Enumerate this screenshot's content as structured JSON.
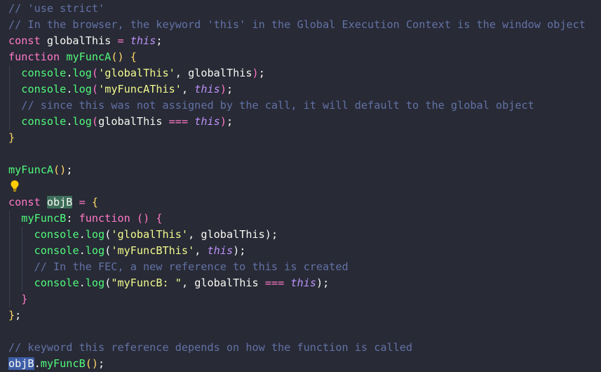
{
  "colors": {
    "background": "#282a36",
    "comment": "#6272a4",
    "keyword": "#ff79c6",
    "function": "#50fa7b",
    "string": "#f1fa8c",
    "this": "#bd93f9",
    "highlight": "#3c6d5a",
    "lightbulb": "#ffcc00"
  },
  "lightbulb_icon": "lightbulb-icon",
  "lines": [
    [
      {
        "t": "comment",
        "v": "// 'use strict'"
      }
    ],
    [
      {
        "t": "comment",
        "v": "// In the browser, the keyword 'this' in the Global Execution Context is the window object"
      }
    ],
    [
      {
        "t": "keyword",
        "v": "const"
      },
      {
        "t": "var",
        "v": " globalThis "
      },
      {
        "t": "op",
        "v": "="
      },
      {
        "t": "var",
        "v": " "
      },
      {
        "t": "this",
        "v": "this"
      },
      {
        "t": "punct",
        "v": ";"
      }
    ],
    [
      {
        "t": "keyword",
        "v": "function"
      },
      {
        "t": "var",
        "v": " "
      },
      {
        "t": "fn",
        "v": "myFuncA"
      },
      {
        "t": "bracket-gold",
        "v": "()"
      },
      {
        "t": "var",
        "v": " "
      },
      {
        "t": "bracket-gold",
        "v": "{"
      }
    ],
    [
      {
        "t": "var",
        "v": "  "
      },
      {
        "t": "fn",
        "v": "console"
      },
      {
        "t": "punct",
        "v": "."
      },
      {
        "t": "fn",
        "v": "log"
      },
      {
        "t": "bracket-pink",
        "v": "("
      },
      {
        "t": "string",
        "v": "'globalThis'"
      },
      {
        "t": "punct",
        "v": ", globalThis"
      },
      {
        "t": "bracket-pink",
        "v": ")"
      },
      {
        "t": "punct",
        "v": ";"
      }
    ],
    [
      {
        "t": "var",
        "v": "  "
      },
      {
        "t": "fn",
        "v": "console"
      },
      {
        "t": "punct",
        "v": "."
      },
      {
        "t": "fn",
        "v": "log"
      },
      {
        "t": "bracket-pink",
        "v": "("
      },
      {
        "t": "string",
        "v": "'myFuncAThis'"
      },
      {
        "t": "punct",
        "v": ", "
      },
      {
        "t": "this",
        "v": "this"
      },
      {
        "t": "bracket-pink",
        "v": ")"
      },
      {
        "t": "punct",
        "v": ";"
      }
    ],
    [
      {
        "t": "var",
        "v": "  "
      },
      {
        "t": "comment",
        "v": "// since this was not assigned by the call, it will default to the global object"
      }
    ],
    [
      {
        "t": "var",
        "v": "  "
      },
      {
        "t": "fn",
        "v": "console"
      },
      {
        "t": "punct",
        "v": "."
      },
      {
        "t": "fn",
        "v": "log"
      },
      {
        "t": "bracket-pink",
        "v": "("
      },
      {
        "t": "punct",
        "v": "globalThis "
      },
      {
        "t": "op",
        "v": "==="
      },
      {
        "t": "punct",
        "v": " "
      },
      {
        "t": "this",
        "v": "this"
      },
      {
        "t": "bracket-pink",
        "v": ")"
      },
      {
        "t": "punct",
        "v": ";"
      }
    ],
    [
      {
        "t": "bracket-gold",
        "v": "}"
      }
    ],
    [],
    [
      {
        "t": "fn",
        "v": "myFuncA"
      },
      {
        "t": "bracket-gold",
        "v": "()"
      },
      {
        "t": "punct",
        "v": ";"
      }
    ],
    [],
    [
      {
        "t": "keyword",
        "v": "const"
      },
      {
        "t": "var",
        "v": " "
      },
      {
        "t": "hl",
        "v": "objB"
      },
      {
        "t": "var",
        "v": " "
      },
      {
        "t": "op",
        "v": "="
      },
      {
        "t": "var",
        "v": " "
      },
      {
        "t": "bracket-gold",
        "v": "{"
      }
    ],
    [
      {
        "t": "var",
        "v": "  "
      },
      {
        "t": "fn",
        "v": "myFuncB"
      },
      {
        "t": "punct",
        "v": ": "
      },
      {
        "t": "keyword",
        "v": "function"
      },
      {
        "t": "var",
        "v": " "
      },
      {
        "t": "bracket-pink",
        "v": "()"
      },
      {
        "t": "var",
        "v": " "
      },
      {
        "t": "bracket-pink",
        "v": "{"
      }
    ],
    [
      {
        "t": "var",
        "v": "    "
      },
      {
        "t": "fn",
        "v": "console"
      },
      {
        "t": "punct",
        "v": "."
      },
      {
        "t": "fn",
        "v": "log"
      },
      {
        "t": "punct",
        "v": "("
      },
      {
        "t": "string",
        "v": "'globalThis'"
      },
      {
        "t": "punct",
        "v": ", globalThis);"
      }
    ],
    [
      {
        "t": "var",
        "v": "    "
      },
      {
        "t": "fn",
        "v": "console"
      },
      {
        "t": "punct",
        "v": "."
      },
      {
        "t": "fn",
        "v": "log"
      },
      {
        "t": "punct",
        "v": "("
      },
      {
        "t": "string",
        "v": "'myFuncBThis'"
      },
      {
        "t": "punct",
        "v": ", "
      },
      {
        "t": "this",
        "v": "this"
      },
      {
        "t": "punct",
        "v": ");"
      }
    ],
    [
      {
        "t": "var",
        "v": "    "
      },
      {
        "t": "comment",
        "v": "// In the FEC, a new reference to this is created"
      }
    ],
    [
      {
        "t": "var",
        "v": "    "
      },
      {
        "t": "fn",
        "v": "console"
      },
      {
        "t": "punct",
        "v": "."
      },
      {
        "t": "fn",
        "v": "log"
      },
      {
        "t": "punct",
        "v": "("
      },
      {
        "t": "string",
        "v": "\"myFuncB: \""
      },
      {
        "t": "punct",
        "v": ", globalThis "
      },
      {
        "t": "op",
        "v": "==="
      },
      {
        "t": "punct",
        "v": " "
      },
      {
        "t": "this",
        "v": "this"
      },
      {
        "t": "punct",
        "v": ");"
      }
    ],
    [
      {
        "t": "var",
        "v": "  "
      },
      {
        "t": "bracket-pink",
        "v": "}"
      }
    ],
    [
      {
        "t": "bracket-gold",
        "v": "}"
      },
      {
        "t": "punct",
        "v": ";"
      }
    ],
    [],
    [
      {
        "t": "comment",
        "v": "// keyword this reference depends on how the function is called"
      }
    ],
    [
      {
        "t": "hl-sel",
        "v": "objB"
      },
      {
        "t": "punct",
        "v": "."
      },
      {
        "t": "fn",
        "v": "myFuncB"
      },
      {
        "t": "bracket-gold",
        "v": "()"
      },
      {
        "t": "punct",
        "v": ";"
      }
    ]
  ]
}
